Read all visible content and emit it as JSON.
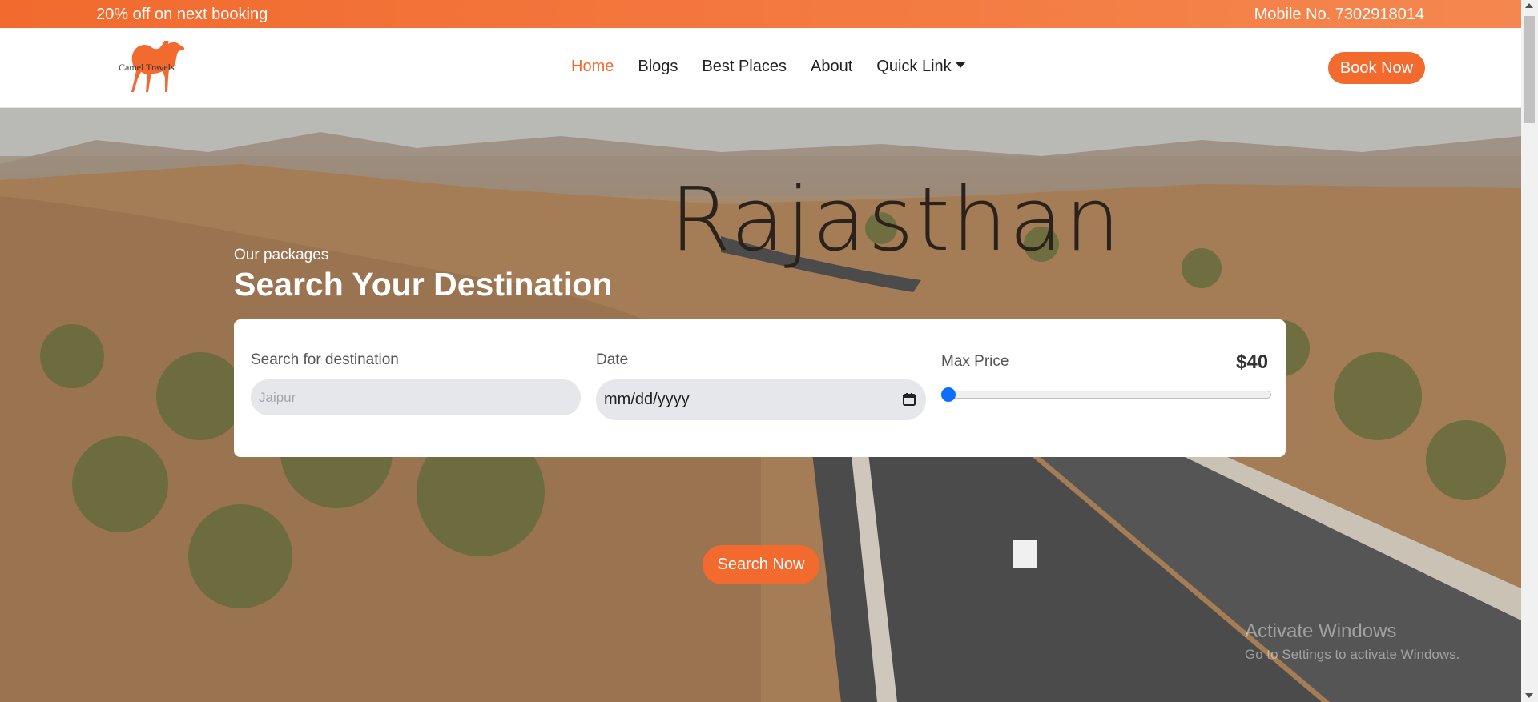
{
  "topbar": {
    "promo": "20% off on next booking",
    "mobile": "Mobile No. 7302918014"
  },
  "nav": {
    "logo_text": "Camel Travels",
    "links": [
      "Home",
      "Blogs",
      "Best Places",
      "About",
      "Quick Link"
    ],
    "active": "Home",
    "book_label": "Book Now"
  },
  "hero": {
    "title": "Rajasthan",
    "eyebrow": "Our packages",
    "heading": "Search Your Destination"
  },
  "search": {
    "destination_label": "Search for destination",
    "destination_placeholder": "Jaipur",
    "date_label": "Date",
    "date_value": "mm/dd/yyyy",
    "price_label": "Max Price",
    "price_value": "$40",
    "price_fraction": 0.0,
    "button_label": "Search Now"
  },
  "watermark": {
    "line1": "Activate Windows",
    "line2": "Go to Settings to activate Windows."
  },
  "colors": {
    "accent": "#f26a2e",
    "slider": "#0d6efd"
  }
}
